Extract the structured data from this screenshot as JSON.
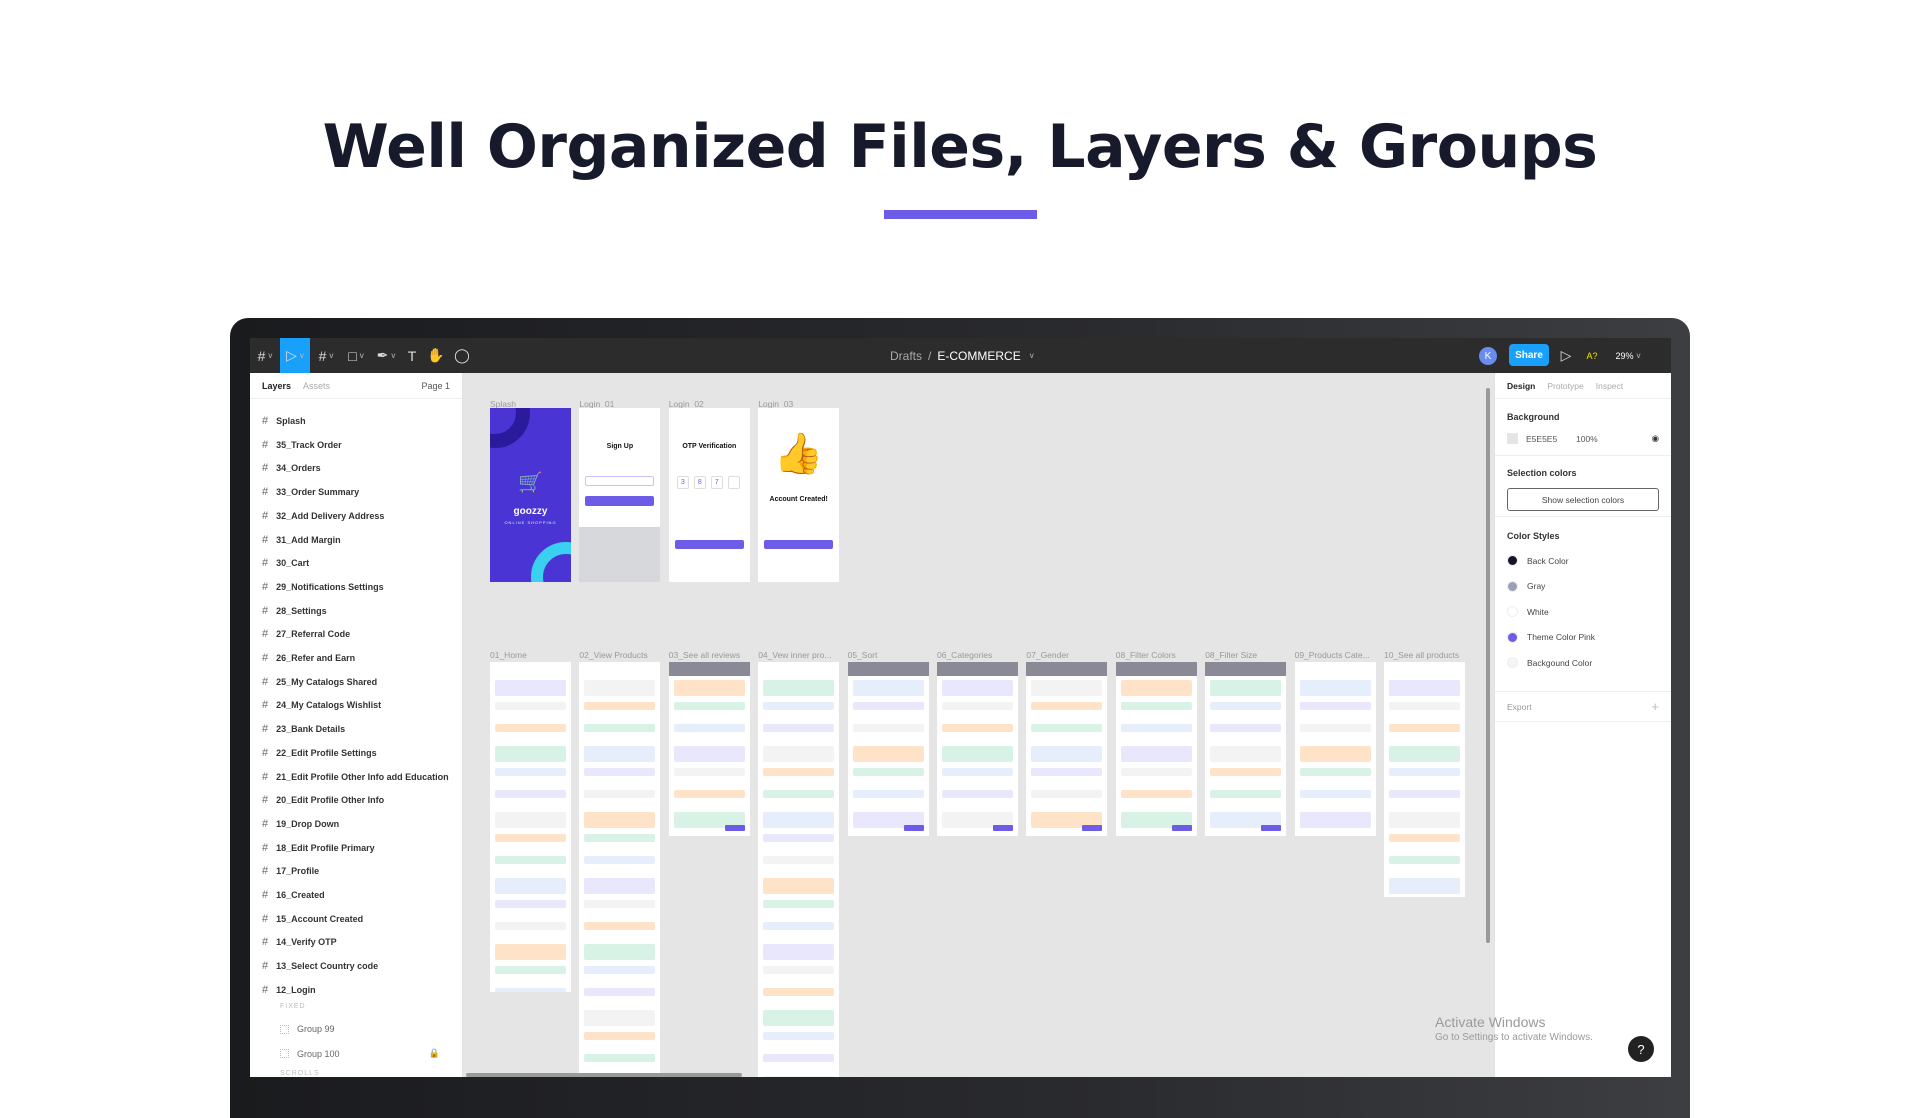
{
  "headline": "Well Organized Files, Layers & Groups",
  "accent": "#6c5ce7",
  "toolbar": {
    "breadcrumb_parent": "Drafts",
    "separator": "/",
    "file_name": "E-COMMERCE",
    "avatar": "K",
    "share": "Share",
    "a11y": "A?",
    "zoom": "29%",
    "tools": [
      "figma-menu-icon",
      "move-tool-icon",
      "frame-tool-icon",
      "shape-tool-icon",
      "pen-tool-icon",
      "text-tool-icon",
      "hand-tool-icon",
      "comment-tool-icon"
    ]
  },
  "left_panel": {
    "tab_layers": "Layers",
    "tab_assets": "Assets",
    "page": "Page 1",
    "layers": [
      "Splash",
      "35_Track Order",
      "34_Orders",
      "33_Order Summary",
      "32_Add Delivery Address",
      "31_Add Margin",
      "30_Cart",
      "29_Notifications Settings",
      "28_Settings",
      "27_Referral Code",
      "26_Refer and Earn",
      "25_My Catalogs Shared",
      "24_My Catalogs Wishlist",
      "23_Bank Details",
      "22_Edit Profile Settings",
      "21_Edit Profile Other Info add Education",
      "20_Edit Profile Other Info",
      "19_Drop Down",
      "18_Edit Profile Primary",
      "17_Profile",
      "16_Created",
      "15_Account Created",
      "14_Verify OTP",
      "13_Select Country code",
      "12_Login"
    ],
    "fixed_label": "FIXED",
    "groups": [
      "Group 99",
      "Group 100"
    ],
    "scrolls_label": "SCROLLS"
  },
  "right_panel": {
    "tabs": [
      "Design",
      "Prototype",
      "Inspect"
    ],
    "background_title": "Background",
    "bg_hex": "E5E5E5",
    "bg_opacity": "100%",
    "selection_title": "Selection colors",
    "selection_button": "Show selection colors",
    "styles_title": "Color Styles",
    "styles": [
      {
        "name": "Back Color",
        "color": "#14142b"
      },
      {
        "name": "Gray",
        "color": "#9aa0b8"
      },
      {
        "name": "White",
        "color": "#ffffff"
      },
      {
        "name": "Theme Color Pink",
        "color": "#6c5ce7"
      },
      {
        "name": "Backgound Color",
        "color": "#f5f5f5"
      }
    ],
    "export": "Export"
  },
  "canvas": {
    "row1": [
      {
        "label": "Splash",
        "brand": "goozzy",
        "tagline": "ONLINE SHOPPING"
      },
      {
        "label": "Login_01",
        "title": "Sign Up"
      },
      {
        "label": "Login_02",
        "title": "OTP Verification",
        "otp": [
          "3",
          "8",
          "7",
          ""
        ]
      },
      {
        "label": "Login_03",
        "title": "Account Created!"
      }
    ],
    "row2": [
      "01_Home",
      "02_View Products",
      "03_See all reviews",
      "04_Vew inner pro...",
      "05_Sort",
      "06_Categories",
      "07_Gender",
      "08_Filter Colors",
      "08_Filter Size",
      "09_Products Cate...",
      "10_See all products"
    ]
  },
  "watermark": {
    "line1": "Activate Windows",
    "line2": "Go to Settings to activate Windows."
  },
  "help": "?"
}
